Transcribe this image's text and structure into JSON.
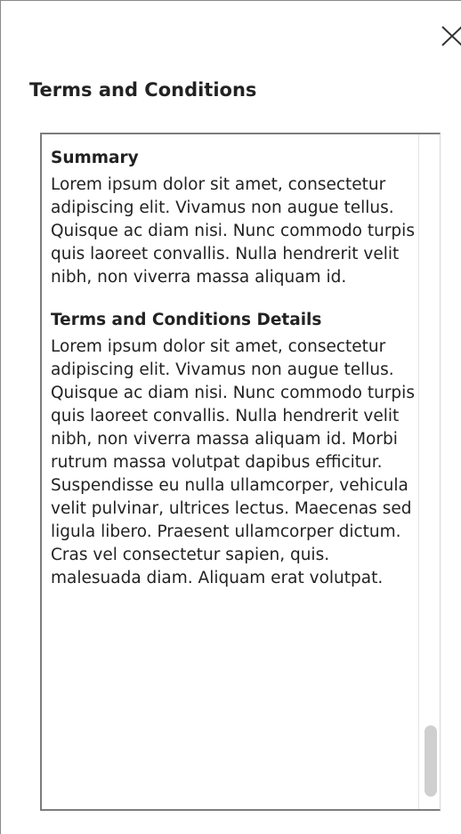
{
  "dialog": {
    "title": "Terms and Conditions",
    "close_icon": "close-icon"
  },
  "terms": {
    "summary_heading": "Summary",
    "summary_text": "Lorem ipsum dolor sit amet, consectetur adipiscing elit. Vivamus non augue tellus. Quisque ac diam nisi. Nunc commodo turpis quis laoreet convallis. Nulla hendrerit velit nibh, non viverra massa aliquam id.",
    "details_heading": "Terms and Conditions Details",
    "details_text": "Lorem ipsum dolor sit amet, consectetur adipiscing elit. Vivamus non augue tellus. Quisque ac diam nisi. Nunc commodo turpis quis laoreet convallis. Nulla hendrerit velit nibh, non viverra massa aliquam id. Morbi rutrum massa volutpat dapibus efficitur. Suspendisse eu nulla ullamcorper, vehicula velit pulvinar, ultrices lectus. Maecenas sed ligula libero. Praesent ullamcorper dictum. Cras vel consectetur sapien, quis. malesuada diam. Aliquam erat volutpat.",
    "scroll_position": 0.92
  }
}
